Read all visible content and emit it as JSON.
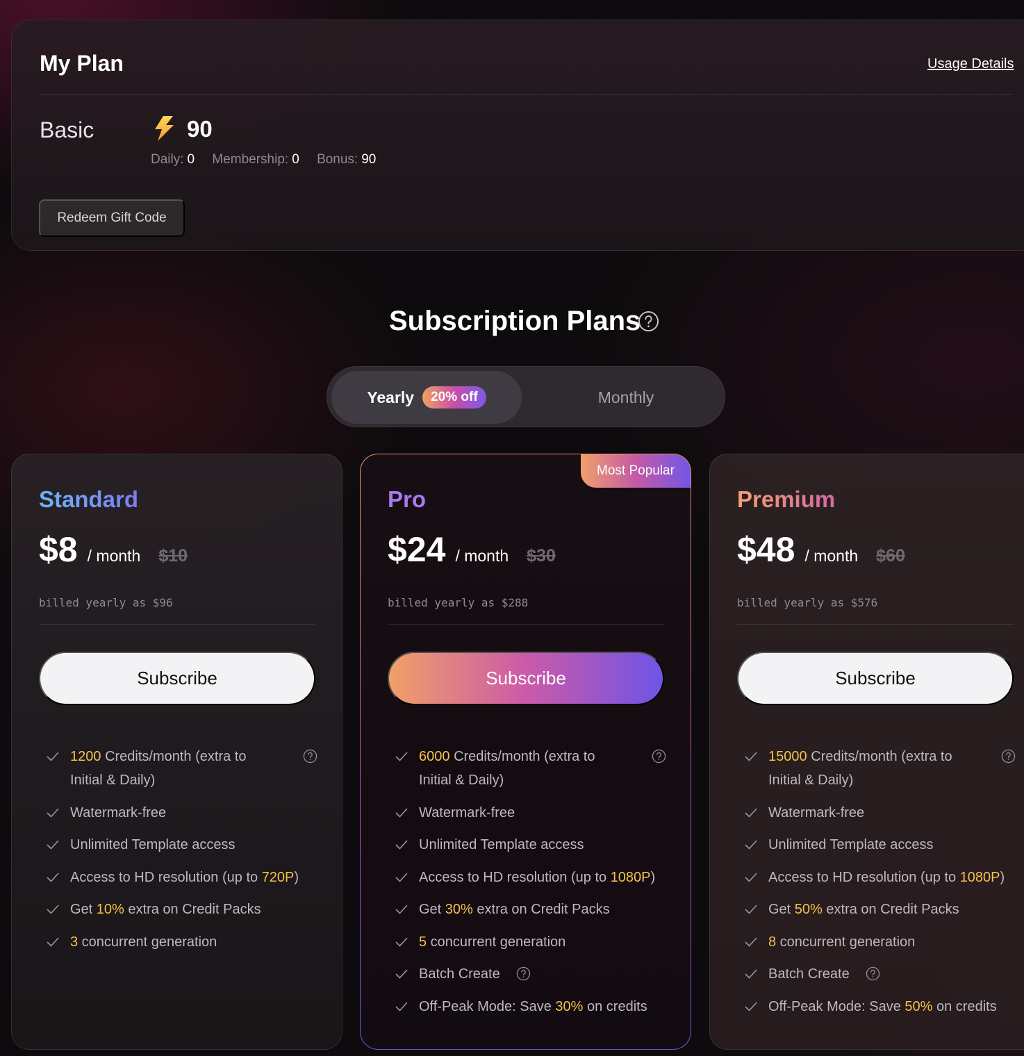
{
  "my_plan": {
    "title": "My Plan",
    "usage_link": "Usage Details",
    "plan_name": "Basic",
    "credits_total": "90",
    "breakdown": {
      "daily_label": "Daily:",
      "daily_value": "0",
      "membership_label": "Membership:",
      "membership_value": "0",
      "bonus_label": "Bonus:",
      "bonus_value": "90"
    },
    "redeem_label": "Redeem Gift Code"
  },
  "subscription": {
    "title": "Subscription Plans",
    "toggle": {
      "yearly": "Yearly",
      "discount": "20% off",
      "monthly": "Monthly",
      "selected": "Yearly"
    }
  },
  "plans": [
    {
      "name": "Standard",
      "price": "$8",
      "per": "/ month",
      "original": "$10",
      "billed": "billed yearly as $96",
      "button": "Subscribe",
      "features": {
        "credits_amount": "1200",
        "credits_text": "Credits/month (extra to Initial & Daily)",
        "watermark": "Watermark-free",
        "templates": "Unlimited Template access",
        "hd_prefix": "Access to HD resolution (up to ",
        "hd_value": "720P",
        "hd_suffix": ")",
        "packs_prefix": "Get ",
        "packs_value": "10%",
        "packs_suffix": " extra on Credit Packs",
        "concurrent_value": "3",
        "concurrent_text": " concurrent generation"
      }
    },
    {
      "name": "Pro",
      "badge": "Most Popular",
      "price": "$24",
      "per": "/ month",
      "original": "$30",
      "billed": "billed yearly as $288",
      "button": "Subscribe",
      "features": {
        "credits_amount": "6000",
        "credits_text": "Credits/month (extra to Initial & Daily)",
        "watermark": "Watermark-free",
        "templates": "Unlimited Template access",
        "hd_prefix": "Access to HD resolution (up to ",
        "hd_value": "1080P",
        "hd_suffix": ")",
        "packs_prefix": "Get ",
        "packs_value": "30%",
        "packs_suffix": " extra on Credit Packs",
        "concurrent_value": "5",
        "concurrent_text": " concurrent generation",
        "batch": "Batch Create",
        "offpeak_prefix": "Off-Peak Mode: Save ",
        "offpeak_value": "30%",
        "offpeak_suffix": " on credits"
      }
    },
    {
      "name": "Premium",
      "price": "$48",
      "per": "/ month",
      "original": "$60",
      "billed": "billed yearly as $576",
      "button": "Subscribe",
      "features": {
        "credits_amount": "15000",
        "credits_text": "Credits/month (extra to Initial & Daily)",
        "watermark": "Watermark-free",
        "templates": "Unlimited Template access",
        "hd_prefix": "Access to HD resolution (up to ",
        "hd_value": "1080P",
        "hd_suffix": ")",
        "packs_prefix": "Get ",
        "packs_value": "50%",
        "packs_suffix": " extra on Credit Packs",
        "concurrent_value": "8",
        "concurrent_text": " concurrent generation",
        "batch": "Batch Create",
        "offpeak_prefix": "Off-Peak Mode: Save ",
        "offpeak_value": "50%",
        "offpeak_suffix": " on credits"
      }
    }
  ],
  "icons": {
    "bolt": "lightning-bolt-icon",
    "help": "question-circle-icon",
    "check": "check-icon"
  },
  "colors": {
    "highlight": "#f5c24a",
    "pro_accent": "#a979f0",
    "gradient_start": "#f0a067",
    "gradient_mid": "#cc5aa8",
    "gradient_end": "#6d55e6"
  }
}
